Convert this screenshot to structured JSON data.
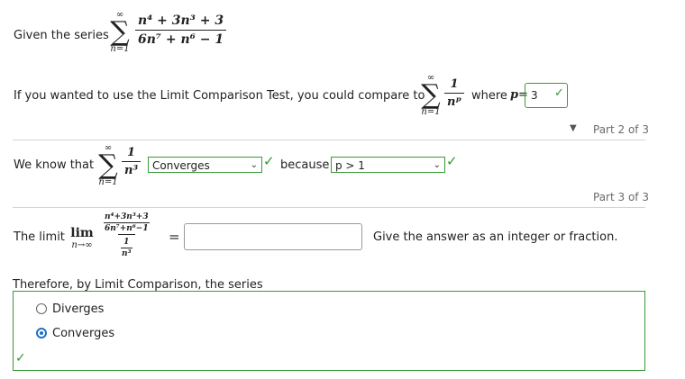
{
  "part1": {
    "given_label": "Given the series",
    "series_sum_upper": "∞",
    "series_sum_lower": "n=1",
    "series_numerator": "n⁴ + 3n³ + 3",
    "series_denominator": "6n⁷ + n⁶ − 1",
    "compare_text": "If you wanted to use the Limit Comparison Test, you could compare to",
    "compare_sum_upper": "∞",
    "compare_sum_lower": "n=1",
    "compare_numerator": "1",
    "compare_denominator": "nᵖ",
    "where_label": "where",
    "p_var": "p",
    "p_equals": "=",
    "p_value": "3"
  },
  "part2": {
    "header": "Part 2 of 3",
    "know_label": "We know that",
    "sum_upper": "∞",
    "sum_lower": "n=1",
    "numerator": "1",
    "denominator": "n³",
    "select1_value": "Converges",
    "because_label": "because",
    "select2_value": "p > 1"
  },
  "part3": {
    "header": "Part 3 of 3",
    "limit_label": "The limit",
    "lim_word": "lim",
    "lim_sub": "n→∞",
    "inner_num": "n⁴+3n³+3",
    "inner_den": "6n⁷+n⁶−1",
    "outer_num": "1",
    "outer_den": "n³",
    "equals": "=",
    "answer_placeholder": "",
    "hint": "Give the answer as an integer or fraction.",
    "therefore_text": "Therefore, by Limit Comparison, the series",
    "options": [
      {
        "label": "Diverges",
        "selected": false
      },
      {
        "label": "Converges",
        "selected": true
      }
    ]
  },
  "icons": {
    "check": "check-icon",
    "triangle": "caret-down-icon"
  },
  "colors": {
    "correct_green": "#2e9a2e",
    "radio_blue": "#1d6fc7"
  }
}
